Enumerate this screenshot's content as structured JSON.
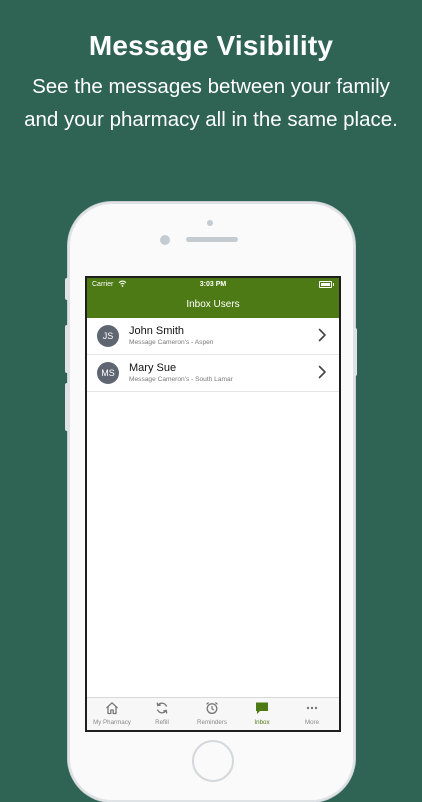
{
  "promo": {
    "headline": "Message Visibility",
    "line1": "See the messages between your family",
    "line2": "and your pharmacy all in the same place."
  },
  "status_bar": {
    "carrier": "Carrier",
    "time": "3:03 PM"
  },
  "nav": {
    "title": "Inbox Users"
  },
  "inbox_users": [
    {
      "initials": "JS",
      "name": "John Smith",
      "subtitle": "Message Cameron's - Aspen"
    },
    {
      "initials": "MS",
      "name": "Mary Sue",
      "subtitle": "Message Cameron's - South Lamar"
    }
  ],
  "tabs": [
    {
      "label": "My Pharmacy",
      "icon": "home-icon"
    },
    {
      "label": "Refill",
      "icon": "refresh-icon"
    },
    {
      "label": "Reminders",
      "icon": "alarm-clock-icon"
    },
    {
      "label": "Inbox",
      "icon": "chat-bubble-icon",
      "active": true
    },
    {
      "label": "More",
      "icon": "more-dots-icon"
    }
  ],
  "colors": {
    "background": "#2f6454",
    "accent": "#4d7a14",
    "avatar": "#5f6672"
  }
}
